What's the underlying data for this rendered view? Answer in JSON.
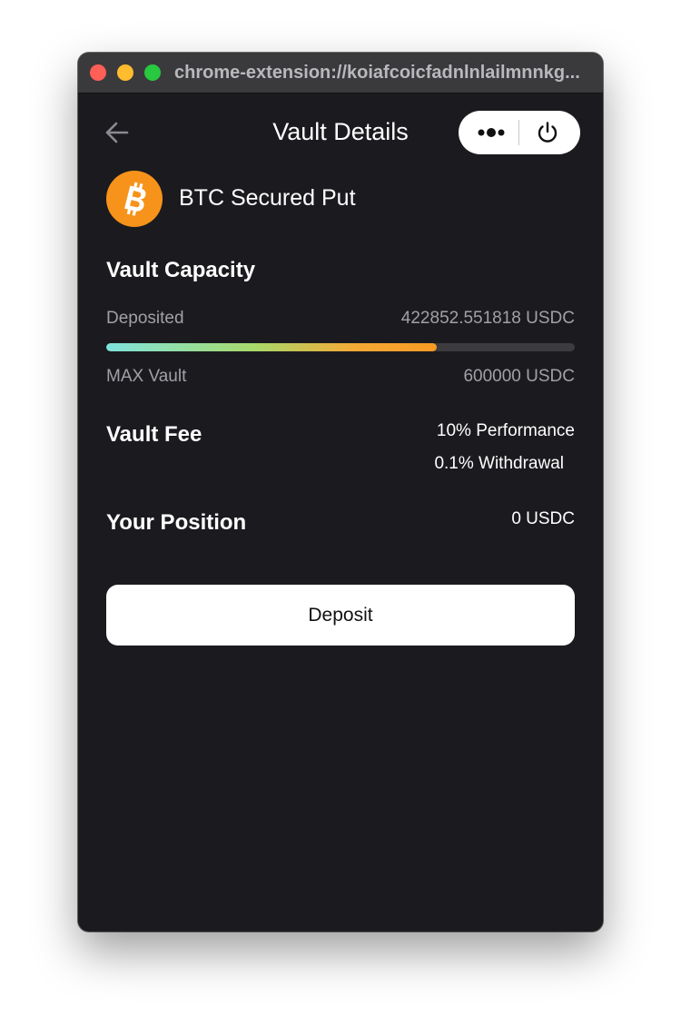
{
  "browser": {
    "url": "chrome-extension://koiafcoicfadnlnlailmnnkg..."
  },
  "header": {
    "title": "Vault Details",
    "back_icon": "arrow-left-icon",
    "menu_icon": "more-dots-icon",
    "power_icon": "power-icon"
  },
  "vault": {
    "asset_icon": "bitcoin-icon",
    "asset_color": "#f7931a",
    "name": "BTC Secured Put"
  },
  "capacity": {
    "title": "Vault Capacity",
    "deposited_label": "Deposited",
    "deposited_value": "422852.551818 USDC",
    "max_label": "MAX Vault",
    "max_value": "600000 USDC",
    "fill_fraction": 0.7048
  },
  "fee": {
    "title": "Vault Fee",
    "performance": "10% Performance",
    "withdrawal": "0.1% Withdrawal"
  },
  "position": {
    "title": "Your Position",
    "value": "0 USDC"
  },
  "actions": {
    "deposit_label": "Deposit"
  },
  "colors": {
    "background": "#1b1b1f",
    "accent": "#f7931a",
    "track": "#3b3b40"
  }
}
